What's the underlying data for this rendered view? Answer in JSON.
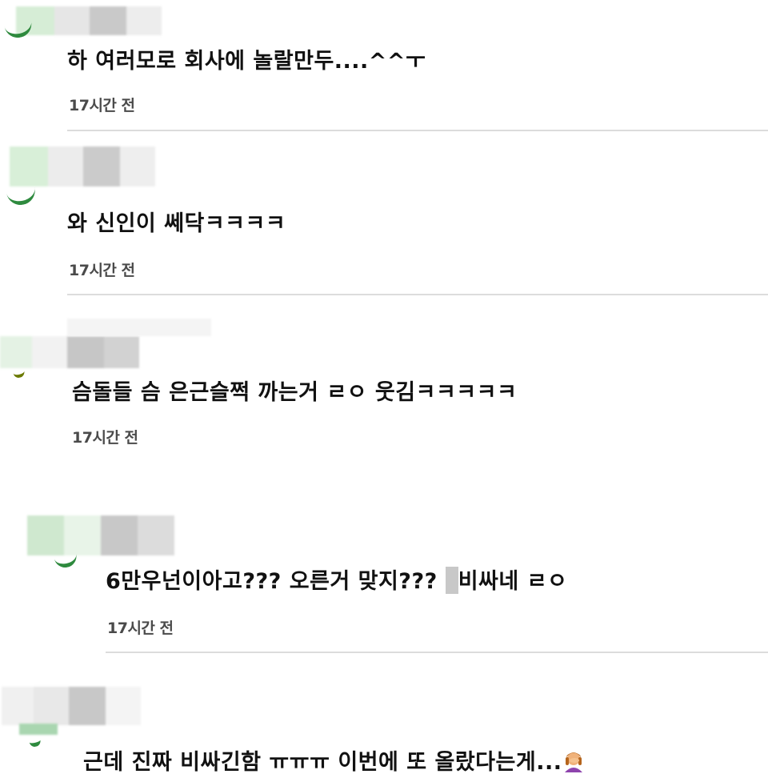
{
  "comments": [
    {
      "text": "하 여러모로 회사에 놀랄만두....^^ㅜ",
      "time": "17시간 전"
    },
    {
      "text": "와 신인이 쎄닥ㅋㅋㅋㅋ",
      "time": "17시간 전"
    },
    {
      "text": "슴돌들 슴 은근슬쩍 까는거 ㄹㅇ 웃김ㅋㅋㅋㅋㅋ",
      "time": "17시간 전"
    },
    {
      "text_before": "6만우넌이아고??? 오른거 맞지??? ",
      "text_after": "비싸네 ㄹㅇ",
      "time": "17시간 전"
    },
    {
      "text": "근데 진짜 비싸긴함 ㅠㅠㅠ 이번에 또 올랐다는게...",
      "emoji": "person-facepalming-emoji"
    }
  ],
  "colors": {
    "avatar_accent": "#2e8a3e",
    "blur_gray": "#c8c8c8",
    "blur_green": "#c7e6c7",
    "divider": "#dcdcdc"
  }
}
